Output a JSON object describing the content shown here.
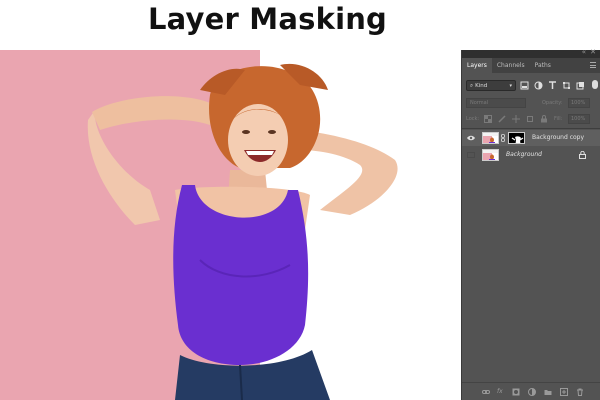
{
  "title": "Layer Masking",
  "panel": {
    "tabs": [
      "Layers",
      "Channels",
      "Paths"
    ],
    "active_tab": "Layers",
    "filter_kind": "Kind",
    "blend_mode": "Normal",
    "opacity_label": "Opacity:",
    "opacity_value": "100%",
    "lock_label": "Lock:",
    "fill_label": "Fill:",
    "fill_value": "100%",
    "layers": [
      {
        "name": "Background copy",
        "visible": true,
        "has_mask": true,
        "selected": true
      },
      {
        "name": "Background",
        "visible": false,
        "has_mask": false,
        "locked": true
      }
    ],
    "bottom_icons": [
      "link-icon",
      "fx-icon",
      "mask-icon",
      "adjustment-icon",
      "folder-icon",
      "new-layer-icon",
      "trash-icon"
    ],
    "fx_text": "fx"
  },
  "colors": {
    "panel_bg": "#535353",
    "photo_pink": "#eaa5b0",
    "top_purple": "#6a2fd0",
    "jeans_blue": "#253b63"
  }
}
